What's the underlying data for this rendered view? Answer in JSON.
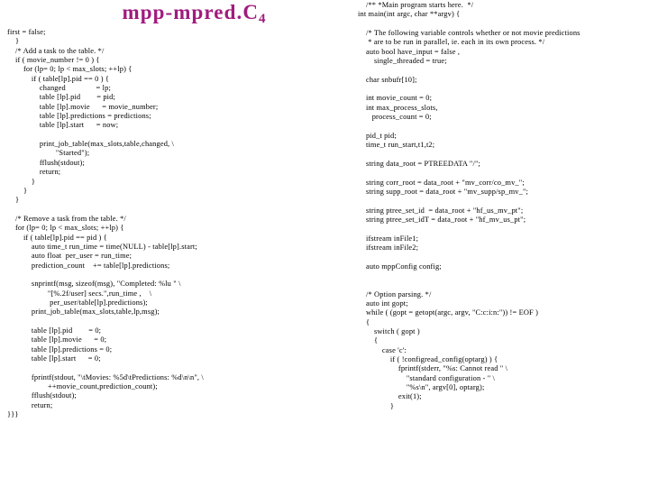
{
  "slide": {
    "title_main": "mpp-mpred.C",
    "title_subscript": "4",
    "title_color": "#A01B7E",
    "background_color": "#FFFFFF"
  },
  "left_column": {
    "lines": [
      "first = false;",
      "    }",
      "    /* Add a task to the table. */",
      "    if ( movie_number != 0 ) {",
      "        for (lp= 0; lp < max_slots; ++lp) {",
      "            if ( table[lp].pid == 0 ) {",
      "                changed               = lp;",
      "                table [lp].pid        = pid;",
      "                table [lp].movie      = movie_number;",
      "                table [lp].predictions = predictions;",
      "                table [lp].start      = now;",
      "",
      "                print_job_table(max_slots,table,changed, \\",
      "                        \"Started\");",
      "                fflush(stdout);",
      "                return;",
      "            }",
      "        }",
      "    }",
      "",
      "    /* Remove a task from the table. */",
      "    for (lp= 0; lp < max_slots; ++lp) {",
      "        if ( table[lp].pid == pid ) {",
      "            auto time_t run_time = time(NULL) - table[lp].start;",
      "            auto float  per_user = run_time;",
      "            prediction_count    += table[lp].predictions;",
      "",
      "            snprintf(msg, sizeof(msg), \"Completed: %lu \" \\",
      "                    \"[%.2f/user] secs.\",run_time ,    \\",
      "                     per_user/table[lp].predictions);",
      "            print_job_table(max_slots,table,lp,msg);",
      "",
      "            table [lp].pid        = 0;",
      "            table [lp].movie      = 0;",
      "            table [lp].predictions = 0;",
      "            table [lp].start      = 0;",
      "",
      "            fprintf(stdout, \"\\tMovies: %5d\\tPredictions: %d\\n\\n\", \\",
      "                    ++movie_count,prediction_count);",
      "            fflush(stdout);",
      "            return;",
      "}}}"
    ]
  },
  "right_column": {
    "lines": [
      "    /** *Main program starts here.  */",
      "int main(int argc, char **argv) {",
      "",
      "    /* The following variable controls whether or not movie predictions",
      "     * are to be run in parallel, ie. each in its own process. */",
      "    auto bool have_input = false ,",
      "        single_threaded = true;",
      "",
      "    char snbufr[10];",
      "",
      "    int movie_count = 0;",
      "    int max_process_slots,",
      "       process_count = 0;",
      "",
      "    pid_t pid;",
      "    time_t run_start,t1,t2;",
      "",
      "    string data_root = PTREEDATA \"/\";",
      "",
      "    string corr_root = data_root + \"mv_corr/co_mv_\";",
      "    string supp_root = data_root + \"mv_supp/sp_mv_\";",
      "",
      "    string ptree_set_id  = data_root + \"hf_us_mv_pt\";",
      "    string ptree_set_idT = data_root + \"hf_mv_us_pt\";",
      "",
      "    ifstream inFile1;",
      "    ifstream inFile2;",
      "",
      "    auto mppConfig config;",
      "",
      "",
      "    /* Option parsing. */",
      "    auto int gopt;",
      "    while ( (gopt = getopt(argc, argv, \"C:c:i:n:\")) != EOF )",
      "    {",
      "        switch ( gopt )",
      "        {",
      "            case 'c':",
      "                if ( !configread_config(optarg) ) {",
      "                    fprintf(stderr, \"%s: Cannot read \" \\",
      "                        \"standard configuration - \" \\",
      "                        \"%s\\n\", argv[0], optarg);",
      "                    exit(1);",
      "                }"
    ]
  }
}
